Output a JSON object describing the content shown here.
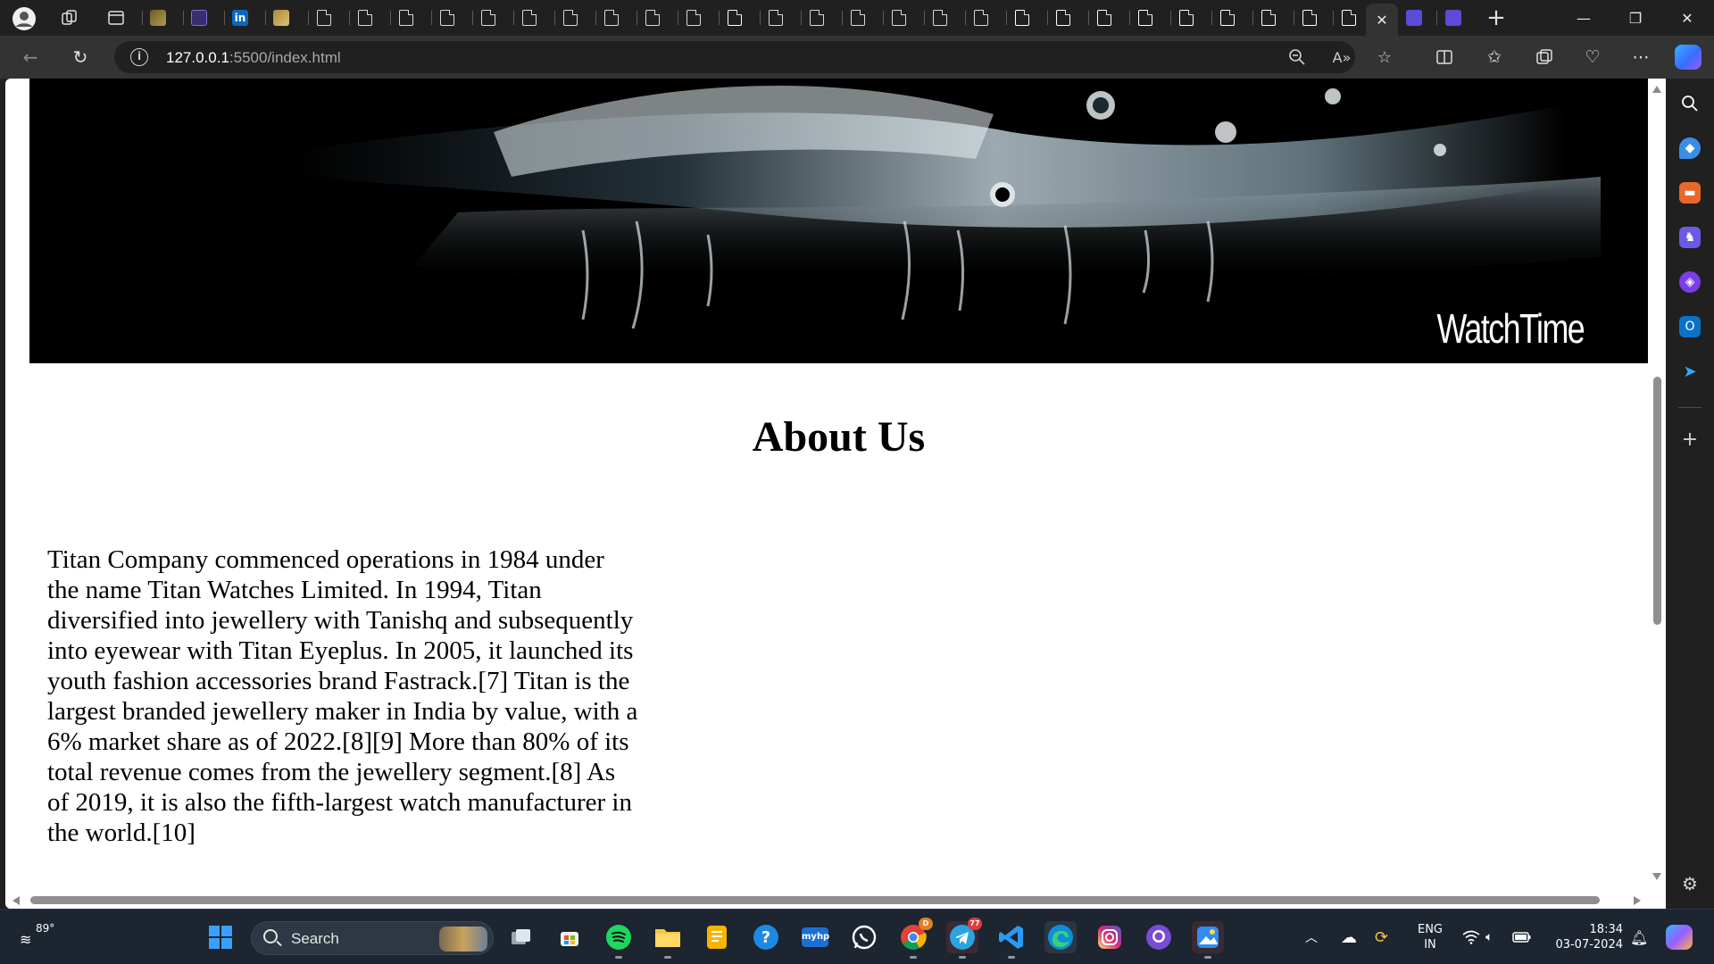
{
  "browser": {
    "address_bar": {
      "url_host": "127.0.0.1",
      "url_path": ":5500/index.html"
    },
    "active_tab_close": "✕"
  },
  "page": {
    "banner_brand": "WatchTime",
    "about_title": "About Us",
    "about_text": "Titan Company commenced operations in 1984 under the name Titan Watches Limited. In 1994, Titan diversified into jewellery with Tanishq and subsequently into eyewear with Titan Eyeplus. In 2005, it launched its youth fashion accessories brand Fastrack.[7] Titan is the largest branded jewellery maker in India by value, with a 6% market share as of 2022.[8][9] More than 80% of its total revenue comes from the jewellery segment.[8] As of 2019, it is also the fifth-largest watch manufacturer in the world.[10]"
  },
  "taskbar": {
    "weather_temp": "89°",
    "search_label": "Search",
    "telegram_badge": "77",
    "chrome_badge": "D",
    "lang_line1": "ENG",
    "lang_line2": "IN",
    "time": "18:34",
    "date": "03-07-2024"
  },
  "colors": {
    "accent": "#4cc2ff",
    "page_background": "#ffffff",
    "chrome_dark": "#202020",
    "toolbar": "#333333"
  }
}
